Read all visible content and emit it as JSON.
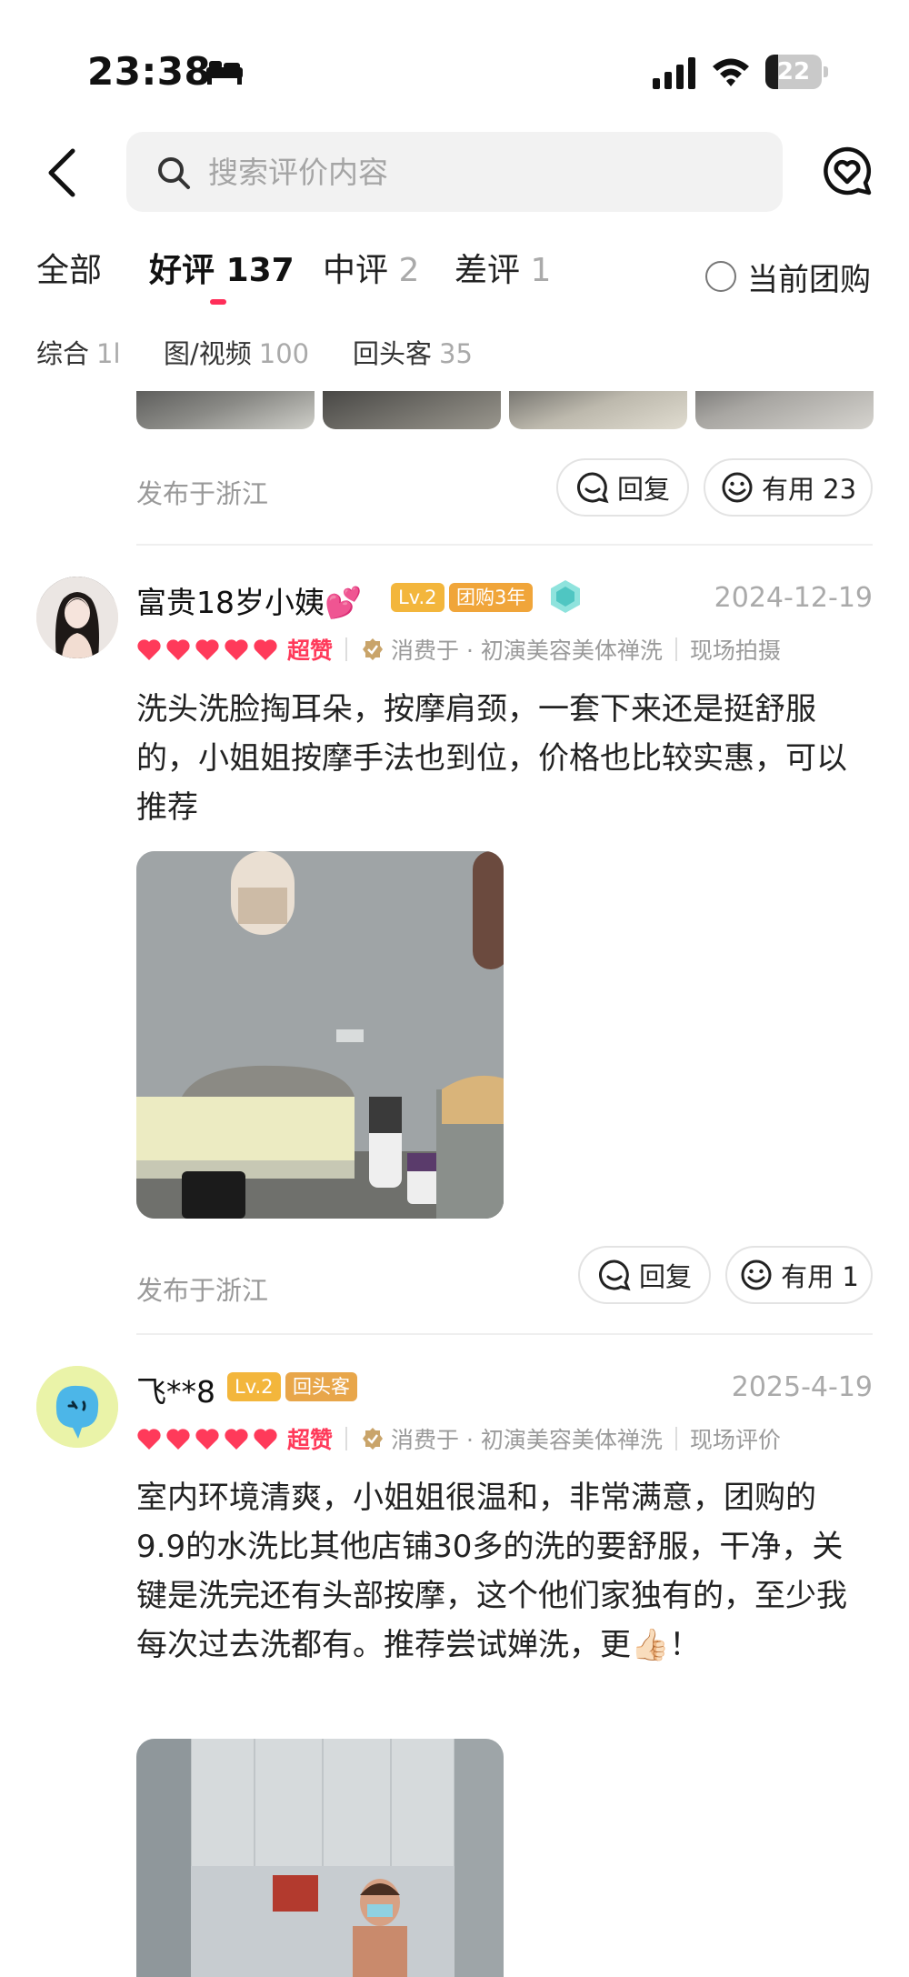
{
  "status_bar": {
    "time": "23:38",
    "battery": "22",
    "battery_level_percent": 22
  },
  "search": {
    "placeholder": "搜索评价内容"
  },
  "tabs": [
    {
      "label": "全部",
      "count": ""
    },
    {
      "label": "好评",
      "count": "137",
      "active": true
    },
    {
      "label": "中评",
      "count": "2"
    },
    {
      "label": "差评",
      "count": "1"
    }
  ],
  "current_group": {
    "label": "当前团购"
  },
  "filters": [
    {
      "label": "综合",
      "count": "1l"
    },
    {
      "label": "图/视频",
      "count": "100"
    },
    {
      "label": "回头客",
      "count": "35"
    }
  ],
  "prev_post": {
    "location": "发布于浙江",
    "reply_label": "回复",
    "useful_label": "有用 23"
  },
  "reviews": [
    {
      "username": "富贵18岁小姨💕",
      "level": "Lv.2",
      "badge": "团购3年",
      "date": "2024-12-19",
      "rating_label": "超赞",
      "merchant": "消费于 · 初演美容美体禅洗",
      "tag": "现场拍摄",
      "text": "洗头洗脸掏耳朵，按摩肩颈，一套下来还是挺舒服的，小姐姐按摩手法也到位，价格也比较实惠，可以推荐",
      "location": "发布于浙江",
      "reply_label": "回复",
      "useful_label": "有用 1"
    },
    {
      "username": "飞**8",
      "level": "Lv.2",
      "badge": "回头客",
      "date": "2025-4-19",
      "rating_label": "超赞",
      "merchant": "消费于 · 初演美容美体禅洗",
      "tag": "现场评价",
      "text": "室内环境清爽，小姐姐很温和，非常满意，团购的9.9的水洗比其他店铺30多的洗的要舒服，干净，关键是洗完还有头部按摩，这个他们家独有的，至少我每次过去洗都有。推荐尝试婵洗，更👍🏻！"
    }
  ],
  "colors": {
    "accent": "#ff2e59",
    "badge": "#f3b63c",
    "heart": "#ff3a5a"
  }
}
